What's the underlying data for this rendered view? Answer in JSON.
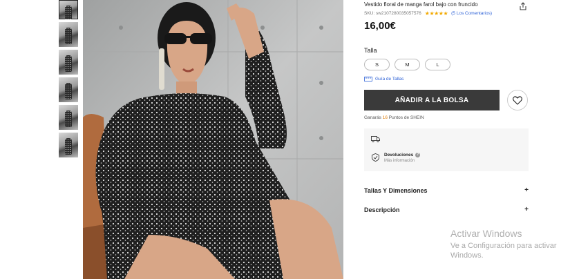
{
  "product": {
    "title": "Vestido floral de manga farol bajo con fruncido",
    "sku": "SKU: sw2107280035057576",
    "stars": "★★★★★",
    "reviews": "(5 Los Comentarios)",
    "price": "16,00€"
  },
  "size": {
    "label": "Talla",
    "options": [
      "S",
      "M",
      "L"
    ],
    "guide": "Guía de Tallas"
  },
  "cart": {
    "add_label": "AÑADIR A LA BOLSA",
    "points_prefix": "Ganarás",
    "points_num": "16",
    "points_suffix": "Puntos de SHEIN"
  },
  "returns": {
    "title": "Devoluciones",
    "more": "Más información"
  },
  "accordion": {
    "sizes": "Tallas Y Dimensiones",
    "description": "Descripción",
    "plus": "+"
  },
  "watermark": {
    "line1": "Activar Windows",
    "line2": "Ve a Configuración para activar",
    "line3": "Windows."
  }
}
